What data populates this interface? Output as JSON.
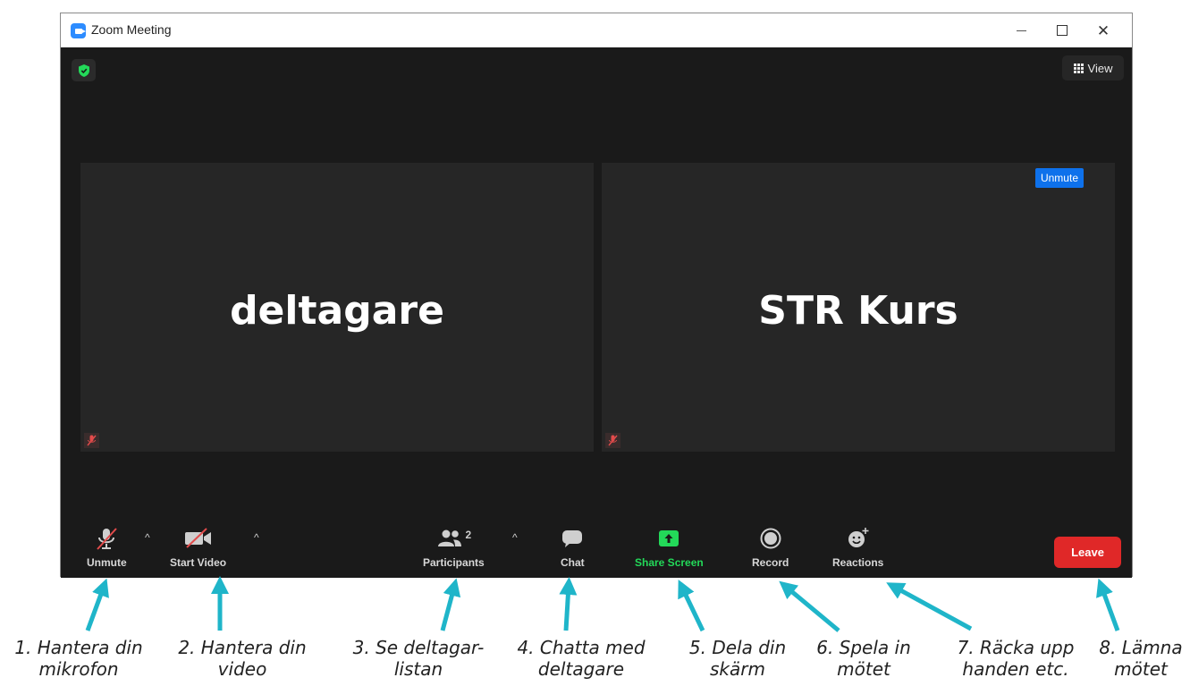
{
  "window": {
    "title": "Zoom Meeting"
  },
  "view_button": {
    "label": "View"
  },
  "tiles": [
    {
      "name": "deltagare"
    },
    {
      "name": "STR Kurs",
      "badge": "Unmute"
    }
  ],
  "toolbar": {
    "unmute": "Unmute",
    "start_video": "Start Video",
    "participants": "Participants",
    "participants_count": "2",
    "chat": "Chat",
    "share_screen": "Share Screen",
    "record": "Record",
    "reactions": "Reactions",
    "leave": "Leave"
  },
  "annotations": [
    {
      "line1": "1. Hantera din",
      "line2": "mikrofon"
    },
    {
      "line1": "2. Hantera din",
      "line2": "video"
    },
    {
      "line1": "3. Se deltagar-",
      "line2": "listan"
    },
    {
      "line1": "4. Chatta med",
      "line2": "deltagare"
    },
    {
      "line1": "5. Dela din",
      "line2": "skärm"
    },
    {
      "line1": "6. Spela in",
      "line2": "mötet"
    },
    {
      "line1": "7. Räcka upp",
      "line2": "handen etc."
    },
    {
      "line1": "8. Lämna",
      "line2": "mötet"
    }
  ],
  "colors": {
    "accent_blue": "#0e71eb",
    "share_green": "#23d959",
    "leave_red": "#e02828",
    "arrow_teal": "#1fb5c9",
    "shield_green": "#23d959"
  }
}
